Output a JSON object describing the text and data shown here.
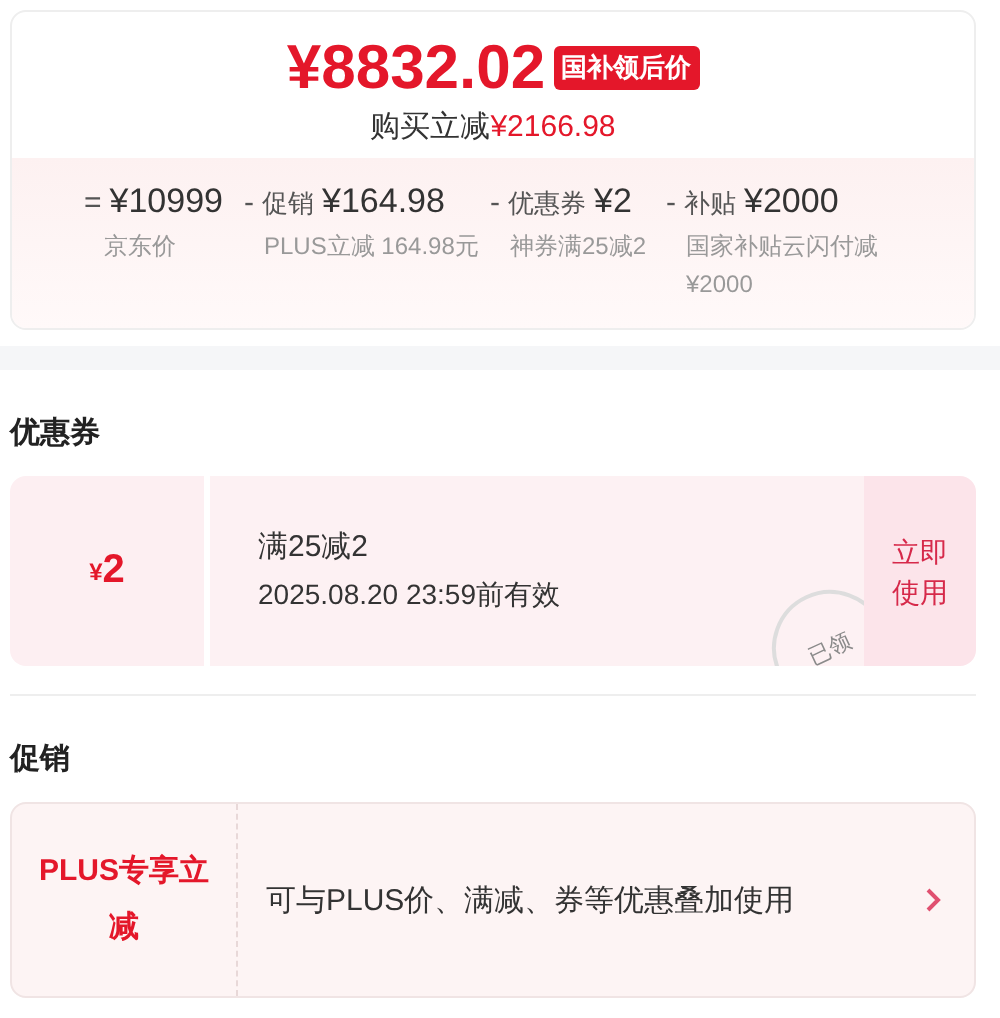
{
  "price_card": {
    "price": "¥8832.02",
    "price_tag": "国补领后价",
    "saving_label": "购买立减",
    "saving_amount": "¥2166.98",
    "breakdown": [
      {
        "operator": "=",
        "amount": "¥10999",
        "note": "京东价"
      },
      {
        "operator": "-",
        "label": "促销",
        "amount": "¥164.98",
        "note": "PLUS立减 164.98元"
      },
      {
        "operator": "-",
        "label": "优惠券",
        "amount": "¥2",
        "note": "神券满25减2"
      },
      {
        "operator": "-",
        "label": "补贴",
        "amount": "¥2000",
        "note": "国家补贴云闪付减¥2000"
      }
    ]
  },
  "coupon_section": {
    "title": "优惠券",
    "coupons": [
      {
        "currency": "¥",
        "value": "2",
        "condition": "满25减2",
        "validity": "2025.08.20 23:59前有效",
        "stamp": "已领",
        "action": "立即使用"
      }
    ]
  },
  "promo_section": {
    "title": "促销",
    "promos": [
      {
        "tag": "PLUS专享立减",
        "description": "可与PLUS价、满减、券等优惠叠加使用"
      }
    ]
  }
}
